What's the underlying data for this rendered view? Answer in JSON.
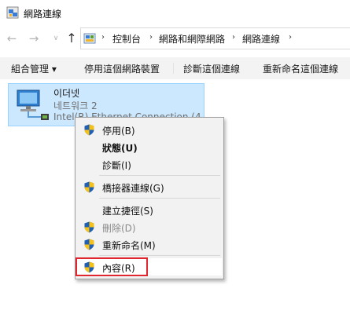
{
  "window": {
    "title": "網路連線"
  },
  "address": {
    "segments": [
      "控制台",
      "網路和網際網路",
      "網路連線"
    ]
  },
  "commandbar": {
    "organize": "組合管理 ▾",
    "disable": "停用這個網路裝置",
    "diagnose": "診斷這個連線",
    "rename": "重新命名這個連線"
  },
  "adapter": {
    "name": "이더넷",
    "status": "네트워크 2",
    "device": "Intel(R) Ethernet Connection (4..."
  },
  "context_menu": {
    "items": [
      {
        "label": "停用(B)",
        "shield": true,
        "bold": false,
        "disabled": false
      },
      {
        "label": "狀態(U)",
        "shield": false,
        "bold": true,
        "disabled": false
      },
      {
        "label": "診斷(I)",
        "shield": false,
        "bold": false,
        "disabled": false
      },
      {
        "label": "橋接器連線(G)",
        "shield": true,
        "bold": false,
        "disabled": false
      },
      {
        "label": "建立捷徑(S)",
        "shield": false,
        "bold": false,
        "disabled": false
      },
      {
        "label": "刪除(D)",
        "shield": true,
        "bold": false,
        "disabled": true
      },
      {
        "label": "重新命名(M)",
        "shield": true,
        "bold": false,
        "disabled": false
      },
      {
        "label": "內容(R)",
        "shield": true,
        "bold": false,
        "disabled": false,
        "highlighted": true
      }
    ]
  },
  "colors": {
    "tile_selected": "#cce8ff",
    "menu_background": "#f2f2f2",
    "highlight_outline": "#e0262f",
    "shield_blue": "#1f5fb4",
    "shield_yellow": "#f6c21a"
  },
  "icons": {
    "title": "network-connections-icon",
    "back": "arrow-left-icon",
    "forward": "arrow-right-icon",
    "recent": "chevron-down-icon",
    "up": "arrow-up-icon",
    "address": "control-panel-icon",
    "adapter": "ethernet-adapter-icon",
    "uac": "uac-shield-icon"
  }
}
